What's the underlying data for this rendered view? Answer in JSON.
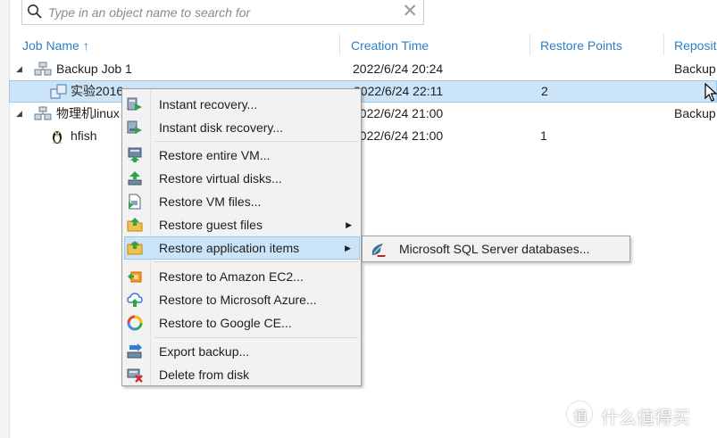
{
  "search": {
    "placeholder": "Type in an object name to search for"
  },
  "columns": {
    "job_name": "Job Name",
    "sort_arrow": "↑",
    "creation_time": "Creation Time",
    "restore_points": "Restore Points",
    "repository": "Reposit"
  },
  "rows": [
    {
      "expander": "◢",
      "name": "Backup Job 1",
      "creation_time": "2022/6/24 20:24",
      "restore_points": "",
      "repository": "Backup"
    },
    {
      "expander": "",
      "name": "实验2016",
      "creation_time": "2022/6/24 22:11",
      "restore_points": "2",
      "repository": ""
    },
    {
      "expander": "◢",
      "name": "物理机linux",
      "creation_time": "2022/6/24 21:00",
      "restore_points": "",
      "repository": "Backup"
    },
    {
      "expander": "",
      "name": "hfish",
      "creation_time": "2022/6/24 21:00",
      "restore_points": "1",
      "repository": ""
    }
  ],
  "context_menu": {
    "items": [
      {
        "label": "Instant recovery...",
        "icon": "instant-recovery-icon"
      },
      {
        "label": "Instant disk recovery...",
        "icon": "instant-disk-recovery-icon"
      },
      {
        "label": "Restore entire VM...",
        "icon": "restore-vm-icon"
      },
      {
        "label": "Restore virtual disks...",
        "icon": "restore-disks-icon"
      },
      {
        "label": "Restore VM files...",
        "icon": "restore-files-icon"
      },
      {
        "label": "Restore guest files",
        "icon": "guest-files-icon",
        "arrow": "▶"
      },
      {
        "label": "Restore application items",
        "icon": "app-items-icon",
        "arrow": "▶"
      },
      {
        "label": "Restore to Amazon EC2...",
        "icon": "amazon-ec2-icon"
      },
      {
        "label": "Restore to Microsoft Azure...",
        "icon": "azure-cloud-icon"
      },
      {
        "label": "Restore to Google CE...",
        "icon": "google-cloud-icon"
      },
      {
        "label": "Export backup...",
        "icon": "export-backup-icon"
      },
      {
        "label": "Delete from disk",
        "icon": "delete-disk-icon"
      }
    ]
  },
  "submenu": {
    "items": [
      {
        "label": "Microsoft SQL Server databases...",
        "icon": "sql-server-icon"
      }
    ]
  },
  "watermark": {
    "glyph": "值",
    "text": "什么值得买"
  },
  "colors": {
    "accent": "#2e7dc6",
    "selection": "#cce4f7",
    "selection_border": "#99c9ef",
    "menu_bg": "#f2f2f2"
  }
}
